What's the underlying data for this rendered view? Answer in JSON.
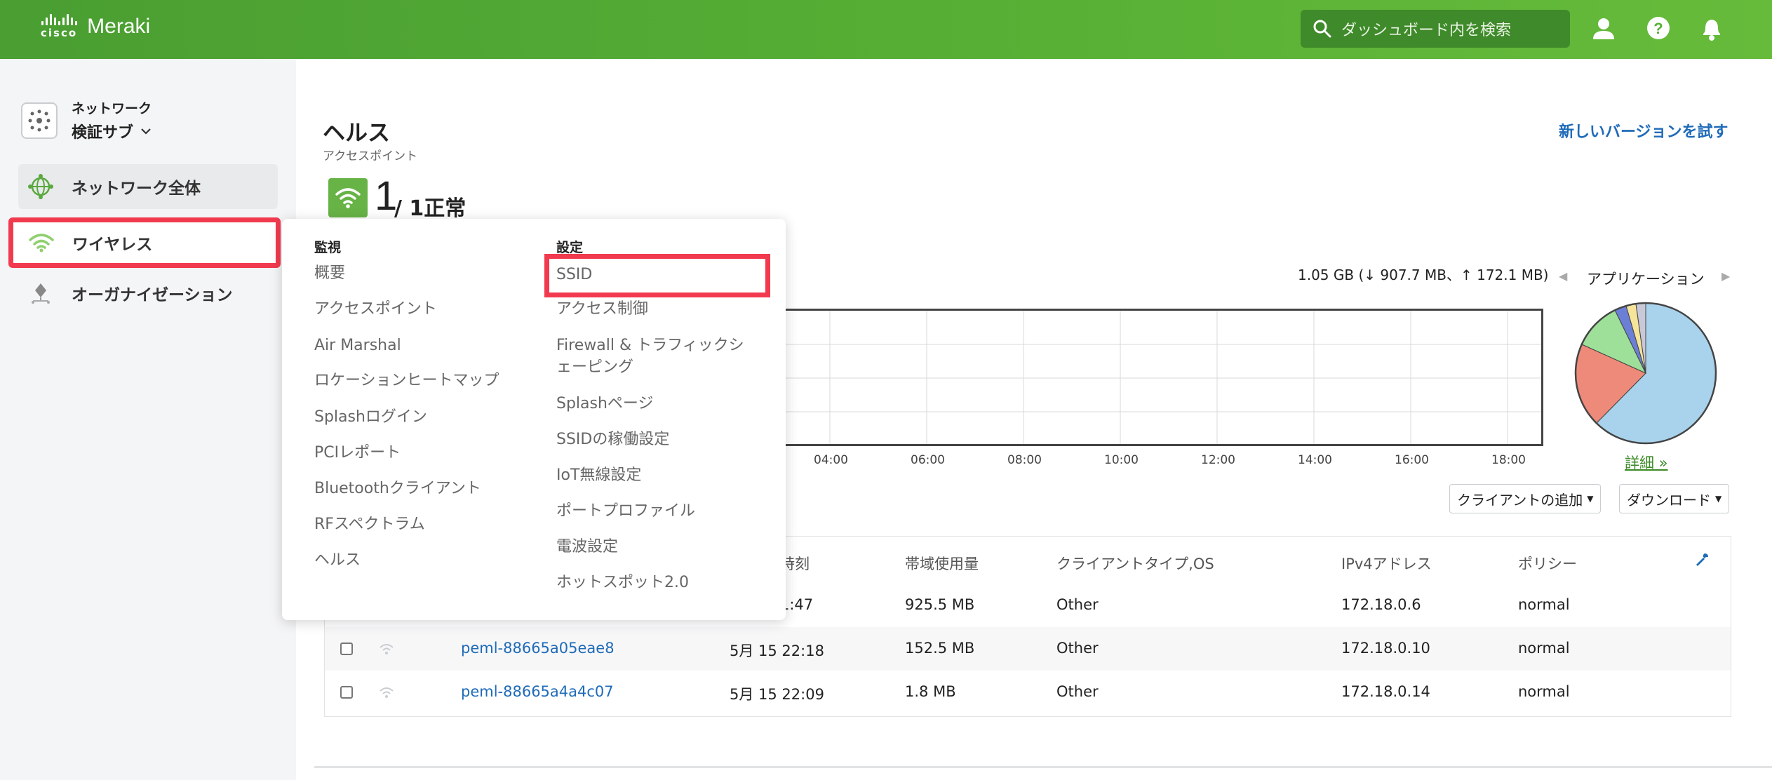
{
  "header": {
    "logo_cisco": "cisco",
    "logo_meraki": "Meraki",
    "search_placeholder": "ダッシュボード内を検索",
    "icons": [
      "search-icon",
      "user-icon",
      "help-icon",
      "bell-icon"
    ]
  },
  "sidebar": {
    "network_label": "ネットワーク",
    "network_value": "検証サブ",
    "items": [
      {
        "label": "ネットワーク全体",
        "icon": "globe-network-icon"
      },
      {
        "label": "ワイヤレス",
        "icon": "wifi-icon"
      },
      {
        "label": "オーガナイゼーション",
        "icon": "organization-icon"
      }
    ]
  },
  "page": {
    "title": "ヘルス",
    "subtitle": "アクセスポイント",
    "try_new": "新しいバージョンを試す",
    "health_count": "1",
    "health_total": "/ 1正常",
    "usage": "1.05 GB (↓ 907.7 MB、↑ 172.1 MB)",
    "x_ticks": [
      "04:00",
      "06:00",
      "08:00",
      "10:00",
      "12:00",
      "14:00",
      "16:00",
      "18:00"
    ],
    "app_title": "アプリケーション",
    "details": "詳細 »",
    "add_client": "クライアントの追加",
    "download": "ダウンロード"
  },
  "pie_colors": {
    "blue": "#a9d3ec",
    "red": "#ee8a7a",
    "green": "#9ee09a",
    "indigo": "#6b7fd6",
    "yellow": "#f5e49a",
    "gray": "#c8c8d8"
  },
  "table": {
    "headers": [
      "時刻",
      "帯域使用量",
      "クライアントタイプ,OS",
      "IPv4アドレス",
      "ポリシー"
    ],
    "rows": [
      {
        "name": "",
        "time": "1:47",
        "usage": "925.5 MB",
        "type": "Other",
        "ip": "172.18.0.6",
        "policy": "normal"
      },
      {
        "name": "peml-88665a05eae8",
        "time": "5月 15 22:18",
        "usage": "152.5 MB",
        "type": "Other",
        "ip": "172.18.0.10",
        "policy": "normal"
      },
      {
        "name": "peml-88665a4a4c07",
        "time": "5月 15 22:09",
        "usage": "1.8 MB",
        "type": "Other",
        "ip": "172.18.0.14",
        "policy": "normal"
      }
    ]
  },
  "menu": {
    "monitor_heading": "監視",
    "monitor_items": [
      "概要",
      "アクセスポイント",
      "Air Marshal",
      "ロケーションヒートマップ",
      "Splashログイン",
      "PCIレポート",
      "Bluetoothクライアント",
      "RFスペクトラム",
      "ヘルス"
    ],
    "config_heading": "設定",
    "config_items": [
      "SSID",
      "アクセス制御",
      "Firewall & トラフィックシ",
      "ェーピング",
      "Splashページ",
      "SSIDの稼働設定",
      "IoT無線設定",
      "ポートプロファイル",
      "電波設定",
      "ホットスポット2.0"
    ]
  }
}
